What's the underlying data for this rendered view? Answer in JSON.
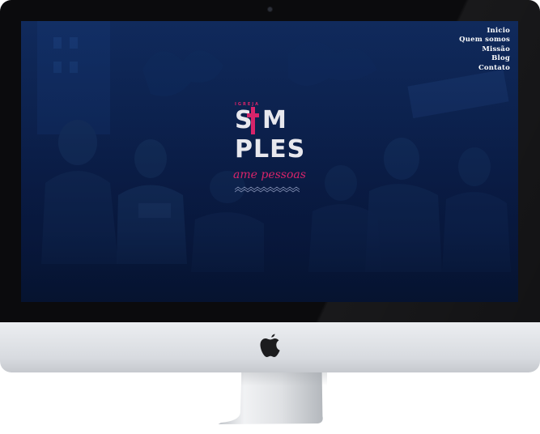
{
  "nav": {
    "items": [
      {
        "label": "Inicio"
      },
      {
        "label": "Quem somos"
      },
      {
        "label": "Missão"
      },
      {
        "label": "Blog"
      },
      {
        "label": "Contato"
      }
    ]
  },
  "logo": {
    "small_text": "IGREJA",
    "line1": "S M",
    "line2": "PLES",
    "tagline": "ame pessoas"
  },
  "colors": {
    "accent": "#d7246a",
    "screen_bg": "#0d2350",
    "logo_text": "#e8e8ee"
  },
  "icons": [
    "apple-logo-icon",
    "cross-icon",
    "camera-icon"
  ]
}
